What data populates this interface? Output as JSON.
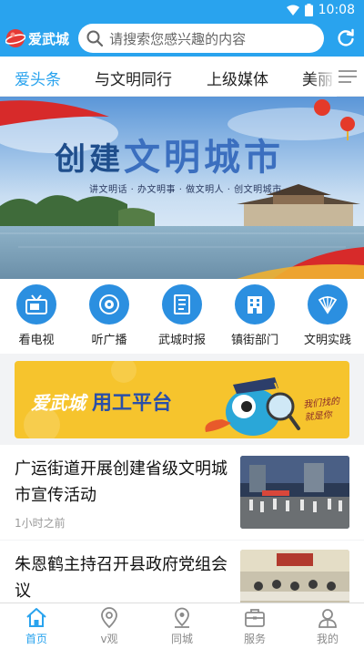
{
  "status": {
    "time": "10:08"
  },
  "header": {
    "app_name": "爱武城",
    "search_placeholder": "请搜索您感兴趣的内容"
  },
  "tabs": [
    {
      "label": "爱头条",
      "active": true
    },
    {
      "label": "与文明同行",
      "active": false
    },
    {
      "label": "上级媒体",
      "active": false
    },
    {
      "label": "美丽",
      "active": false
    }
  ],
  "banner": {
    "title_a": "创建",
    "title_b": "文明城市",
    "subtitle": "讲文明话 · 办文明事 · 做文明人 · 创文明城市"
  },
  "quick_links": [
    {
      "label": "看电视",
      "icon": "tv-icon"
    },
    {
      "label": "听广播",
      "icon": "radio-icon"
    },
    {
      "label": "武城时报",
      "icon": "newspaper-icon"
    },
    {
      "label": "镇街部门",
      "icon": "building-icon"
    },
    {
      "label": "文明实践",
      "icon": "fan-icon"
    }
  ],
  "ad": {
    "brand": "爱武城",
    "title": "用工平台",
    "slogan_1": "我们找的",
    "slogan_2": "就是你"
  },
  "news": [
    {
      "title": "广运街道开展创建省级文明城市宣传活动",
      "meta": "1小时之前"
    },
    {
      "title": "朱恩鹤主持召开县政府党组会议",
      "meta": ""
    }
  ],
  "bottom_nav": [
    {
      "label": "首页",
      "icon": "home-icon",
      "active": true
    },
    {
      "label": "v观",
      "icon": "location-pin-icon",
      "active": false
    },
    {
      "label": "同城",
      "icon": "map-pin-icon",
      "active": false
    },
    {
      "label": "服务",
      "icon": "briefcase-icon",
      "active": false
    },
    {
      "label": "我的",
      "icon": "profile-icon",
      "active": false
    }
  ],
  "colors": {
    "primary": "#29a3ee",
    "icon_blue": "#2b8fe0",
    "ad_yellow": "#f6c42d"
  }
}
